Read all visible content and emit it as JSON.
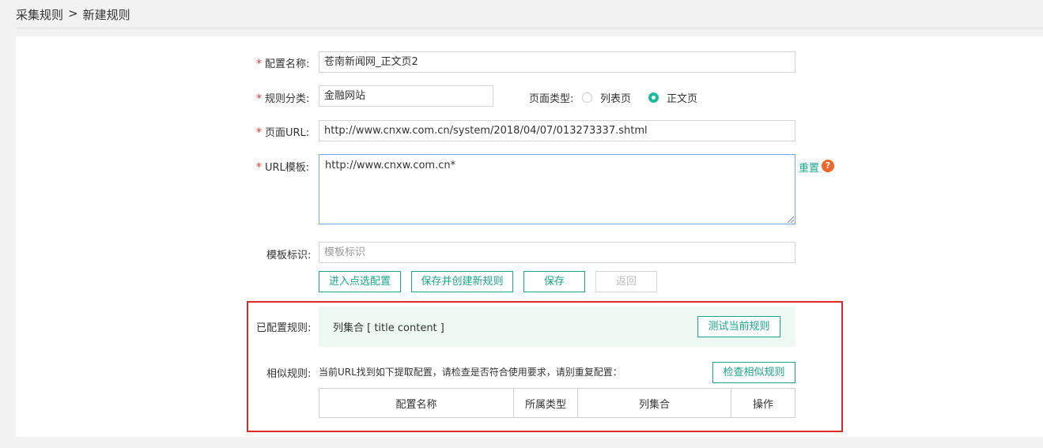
{
  "breadcrumb": {
    "root": "采集规则",
    "sep": ">",
    "current": "新建规则"
  },
  "form": {
    "name": {
      "label": "配置名称:",
      "value": "苍南新闻网_正文页2"
    },
    "category": {
      "label": "规则分类:",
      "value": "金融网站"
    },
    "page_type": {
      "label": "页面类型:",
      "options": [
        "列表页",
        "正文页"
      ],
      "selected": "正文页"
    },
    "page_url": {
      "label": "页面URL:",
      "value": "http://www.cnxw.com.cn/system/2018/04/07/013273337.shtml"
    },
    "url_template": {
      "label": "URL模板:",
      "value": "http://www.cnxw.com.cn*",
      "reset": "重置",
      "help": "?"
    },
    "template_tag": {
      "label": "模板标识:",
      "placeholder": "模板标识"
    }
  },
  "buttons": {
    "enter_select": "进入点选配置",
    "save_create": "保存并创建新规则",
    "save": "保存",
    "back": "返回"
  },
  "configured": {
    "label": "已配置规则:",
    "text": "列集合 [ title  content ]",
    "test_button": "测试当前规则"
  },
  "similar": {
    "label": "相似规则:",
    "hint": "当前URL找到如下提取配置，请检查是否符合使用要求，请别重复配置：",
    "check_button": "检查相似规则",
    "columns": [
      "配置名称",
      "所属类型",
      "列集合",
      "操作"
    ]
  },
  "colors": {
    "accent": "#1aa58a",
    "required": "#e4393c",
    "highlight_border": "#e02a2a"
  }
}
